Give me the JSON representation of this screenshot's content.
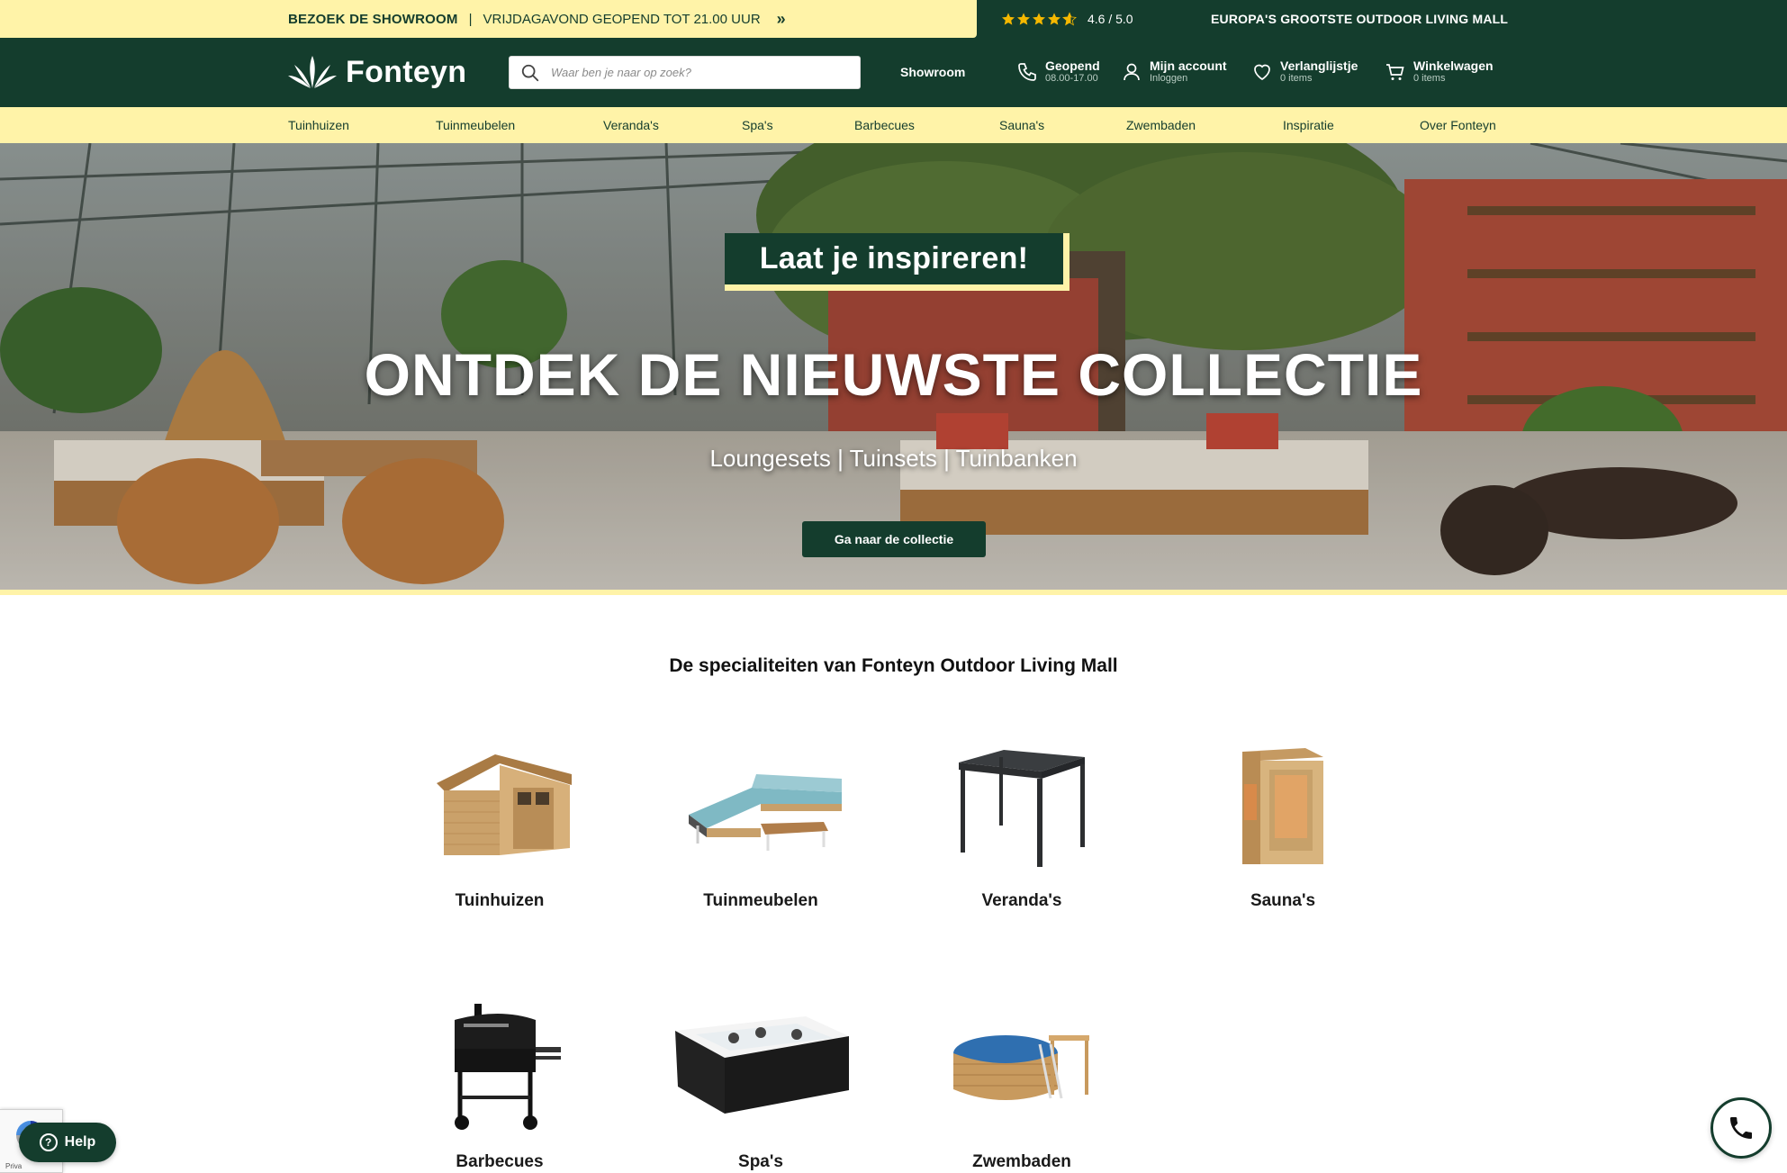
{
  "promo": {
    "visit": "BEZOEK DE SHOWROOM",
    "separator": "|",
    "hours": "VRIJDAGAVOND GEOPEND TOT 21.00 UUR",
    "chevron": "»",
    "rating_value": 4.6,
    "rating": "4.6 / 5.0",
    "tagline": "EUROPA'S GROOTSTE OUTDOOR LIVING MALL"
  },
  "header": {
    "logo": "Fonteyn",
    "search_placeholder": "Waar ben je naar op zoek?",
    "showroom": "Showroom",
    "open_title": "Geopend",
    "open_hours": "08.00-17.00",
    "account_title": "Mijn account",
    "account_sub": "Inloggen",
    "wishlist_title": "Verlanglijstje",
    "wishlist_sub": "0 items",
    "cart_title": "Winkelwagen",
    "cart_sub": "0 items"
  },
  "nav": {
    "items": [
      "Tuinhuizen",
      "Tuinmeubelen",
      "Veranda's",
      "Spa's",
      "Barbecues",
      "Sauna's",
      "Zwembaden",
      "Inspiratie",
      "Over Fonteyn"
    ]
  },
  "hero": {
    "badge": "Laat je inspireren!",
    "title": "ONTDEK DE NIEUWSTE COLLECTIE",
    "subtitle": "Loungesets | Tuinsets | Tuinbanken",
    "button": "Ga naar de collectie"
  },
  "specialties": {
    "title": "De specialiteiten van Fonteyn Outdoor Living Mall",
    "items": [
      "Tuinhuizen",
      "Tuinmeubelen",
      "Veranda's",
      "Sauna's",
      "Barbecues",
      "Spa's",
      "Zwembaden"
    ]
  },
  "widgets": {
    "help": "Help",
    "privacy": "Priva"
  },
  "colors": {
    "brand_green": "#143d2d",
    "brand_yellow": "#fff3a8",
    "star": "#f5b800"
  }
}
